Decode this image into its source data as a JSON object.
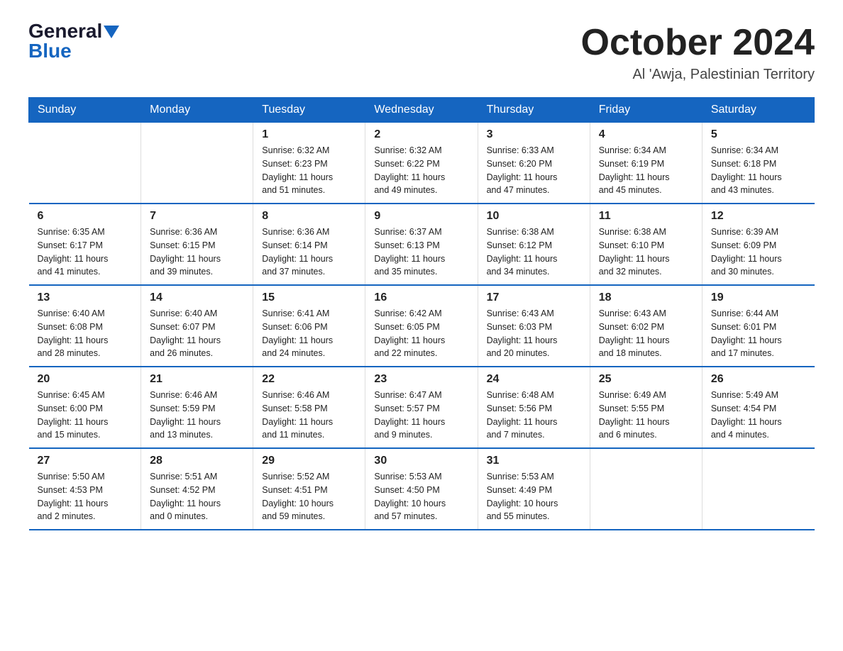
{
  "logo": {
    "general": "General",
    "blue": "Blue"
  },
  "title": {
    "month": "October 2024",
    "location": "Al 'Awja, Palestinian Territory"
  },
  "headers": [
    "Sunday",
    "Monday",
    "Tuesday",
    "Wednesday",
    "Thursday",
    "Friday",
    "Saturday"
  ],
  "weeks": [
    [
      {
        "day": "",
        "info": ""
      },
      {
        "day": "",
        "info": ""
      },
      {
        "day": "1",
        "info": "Sunrise: 6:32 AM\nSunset: 6:23 PM\nDaylight: 11 hours\nand 51 minutes."
      },
      {
        "day": "2",
        "info": "Sunrise: 6:32 AM\nSunset: 6:22 PM\nDaylight: 11 hours\nand 49 minutes."
      },
      {
        "day": "3",
        "info": "Sunrise: 6:33 AM\nSunset: 6:20 PM\nDaylight: 11 hours\nand 47 minutes."
      },
      {
        "day": "4",
        "info": "Sunrise: 6:34 AM\nSunset: 6:19 PM\nDaylight: 11 hours\nand 45 minutes."
      },
      {
        "day": "5",
        "info": "Sunrise: 6:34 AM\nSunset: 6:18 PM\nDaylight: 11 hours\nand 43 minutes."
      }
    ],
    [
      {
        "day": "6",
        "info": "Sunrise: 6:35 AM\nSunset: 6:17 PM\nDaylight: 11 hours\nand 41 minutes."
      },
      {
        "day": "7",
        "info": "Sunrise: 6:36 AM\nSunset: 6:15 PM\nDaylight: 11 hours\nand 39 minutes."
      },
      {
        "day": "8",
        "info": "Sunrise: 6:36 AM\nSunset: 6:14 PM\nDaylight: 11 hours\nand 37 minutes."
      },
      {
        "day": "9",
        "info": "Sunrise: 6:37 AM\nSunset: 6:13 PM\nDaylight: 11 hours\nand 35 minutes."
      },
      {
        "day": "10",
        "info": "Sunrise: 6:38 AM\nSunset: 6:12 PM\nDaylight: 11 hours\nand 34 minutes."
      },
      {
        "day": "11",
        "info": "Sunrise: 6:38 AM\nSunset: 6:10 PM\nDaylight: 11 hours\nand 32 minutes."
      },
      {
        "day": "12",
        "info": "Sunrise: 6:39 AM\nSunset: 6:09 PM\nDaylight: 11 hours\nand 30 minutes."
      }
    ],
    [
      {
        "day": "13",
        "info": "Sunrise: 6:40 AM\nSunset: 6:08 PM\nDaylight: 11 hours\nand 28 minutes."
      },
      {
        "day": "14",
        "info": "Sunrise: 6:40 AM\nSunset: 6:07 PM\nDaylight: 11 hours\nand 26 minutes."
      },
      {
        "day": "15",
        "info": "Sunrise: 6:41 AM\nSunset: 6:06 PM\nDaylight: 11 hours\nand 24 minutes."
      },
      {
        "day": "16",
        "info": "Sunrise: 6:42 AM\nSunset: 6:05 PM\nDaylight: 11 hours\nand 22 minutes."
      },
      {
        "day": "17",
        "info": "Sunrise: 6:43 AM\nSunset: 6:03 PM\nDaylight: 11 hours\nand 20 minutes."
      },
      {
        "day": "18",
        "info": "Sunrise: 6:43 AM\nSunset: 6:02 PM\nDaylight: 11 hours\nand 18 minutes."
      },
      {
        "day": "19",
        "info": "Sunrise: 6:44 AM\nSunset: 6:01 PM\nDaylight: 11 hours\nand 17 minutes."
      }
    ],
    [
      {
        "day": "20",
        "info": "Sunrise: 6:45 AM\nSunset: 6:00 PM\nDaylight: 11 hours\nand 15 minutes."
      },
      {
        "day": "21",
        "info": "Sunrise: 6:46 AM\nSunset: 5:59 PM\nDaylight: 11 hours\nand 13 minutes."
      },
      {
        "day": "22",
        "info": "Sunrise: 6:46 AM\nSunset: 5:58 PM\nDaylight: 11 hours\nand 11 minutes."
      },
      {
        "day": "23",
        "info": "Sunrise: 6:47 AM\nSunset: 5:57 PM\nDaylight: 11 hours\nand 9 minutes."
      },
      {
        "day": "24",
        "info": "Sunrise: 6:48 AM\nSunset: 5:56 PM\nDaylight: 11 hours\nand 7 minutes."
      },
      {
        "day": "25",
        "info": "Sunrise: 6:49 AM\nSunset: 5:55 PM\nDaylight: 11 hours\nand 6 minutes."
      },
      {
        "day": "26",
        "info": "Sunrise: 5:49 AM\nSunset: 4:54 PM\nDaylight: 11 hours\nand 4 minutes."
      }
    ],
    [
      {
        "day": "27",
        "info": "Sunrise: 5:50 AM\nSunset: 4:53 PM\nDaylight: 11 hours\nand 2 minutes."
      },
      {
        "day": "28",
        "info": "Sunrise: 5:51 AM\nSunset: 4:52 PM\nDaylight: 11 hours\nand 0 minutes."
      },
      {
        "day": "29",
        "info": "Sunrise: 5:52 AM\nSunset: 4:51 PM\nDaylight: 10 hours\nand 59 minutes."
      },
      {
        "day": "30",
        "info": "Sunrise: 5:53 AM\nSunset: 4:50 PM\nDaylight: 10 hours\nand 57 minutes."
      },
      {
        "day": "31",
        "info": "Sunrise: 5:53 AM\nSunset: 4:49 PM\nDaylight: 10 hours\nand 55 minutes."
      },
      {
        "day": "",
        "info": ""
      },
      {
        "day": "",
        "info": ""
      }
    ]
  ]
}
